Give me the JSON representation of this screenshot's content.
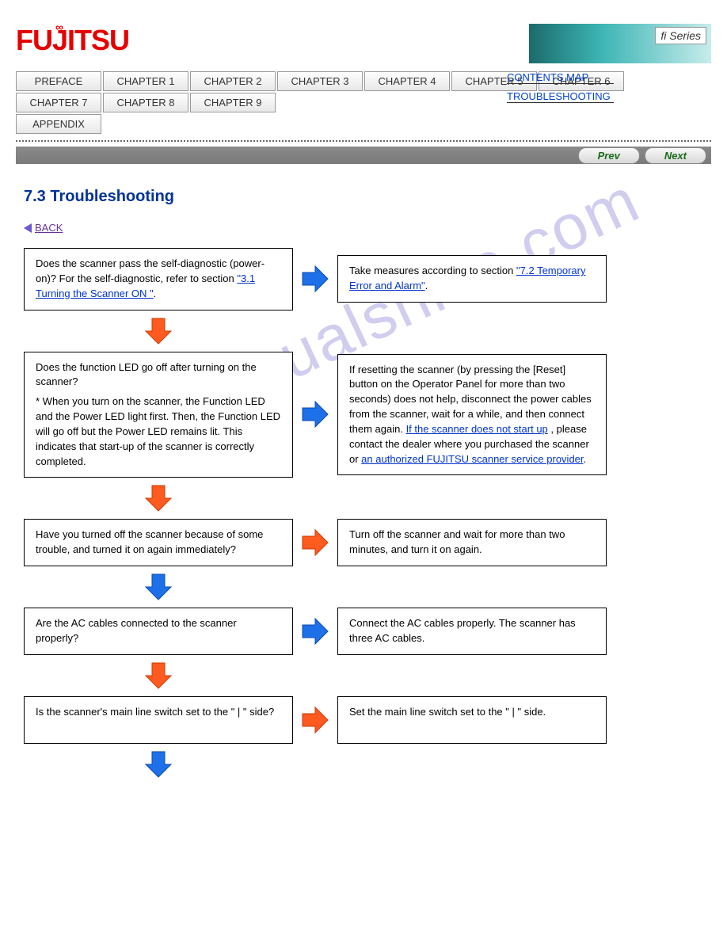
{
  "logo": "FUJITSU",
  "fi_series": "fi Series",
  "nav": {
    "tabs": [
      "PREFACE",
      "CHAPTER 1",
      "CHAPTER 2",
      "CHAPTER 3",
      "CHAPTER 4",
      "CHAPTER 5",
      "CHAPTER 6",
      "CHAPTER 7",
      "CHAPTER 8",
      "CHAPTER 9",
      "APPENDIX"
    ],
    "side": [
      "CONTENTS MAP",
      "TROUBLESHOOTING"
    ]
  },
  "buttons": {
    "prev": "Prev",
    "next": "Next"
  },
  "title": "7.3 Troubleshooting",
  "back": "BACK",
  "watermark": "manualshive.com",
  "flow": {
    "r1": {
      "left_pre": "Does the scanner pass the self-diagnostic (power-on)? For the self-diagnostic, refer to section ",
      "left_link": "\"3.1 Turning the Scanner ON \"",
      "left_post": ".",
      "arrow1": "blue",
      "right_pre": "Take measures according to section ",
      "right_link": "\"7.2 Temporary Error and Alarm\"",
      "right_post": ".",
      "down": "orange"
    },
    "r2": {
      "left_q": "Does the function LED go off after turning on the scanner?",
      "left_note": "* When you turn on the scanner, the Function LED and the Power LED light first. Then, the Function LED will go off but the Power LED remains lit. This indicates that start-up of the scanner is correctly completed.",
      "arrow1": "blue",
      "right_pre": "If resetting the scanner (by pressing the [Reset] button on the Operator Panel for more than two seconds) does not help, disconnect the power cables from the scanner, wait for a while, and then connect them again.",
      "right_link1": "If the scanner does not start up",
      "right_mid": ", please contact the dealer where you purchased the scanner or ",
      "right_link2": "an authorized FUJITSU scanner service provider",
      "right_post": ".",
      "down": "orange"
    },
    "r3": {
      "left": "Have you turned off the scanner because of some trouble, and turned it on again immediately?",
      "arrow1": "orange",
      "right": "Turn off the scanner and wait for more than two minutes, and turn it on again.",
      "down": "blue"
    },
    "r4": {
      "left": "Are the AC cables connected to the scanner properly?",
      "arrow1": "blue",
      "right": "Connect the AC cables properly. The scanner has three AC cables.",
      "down": "orange"
    },
    "r5": {
      "left": "Is the scanner's main line switch set to the \" | \" side?",
      "arrow1": "orange",
      "right": "Set the main line switch set to the \" | \" side.",
      "down": "blue"
    }
  }
}
